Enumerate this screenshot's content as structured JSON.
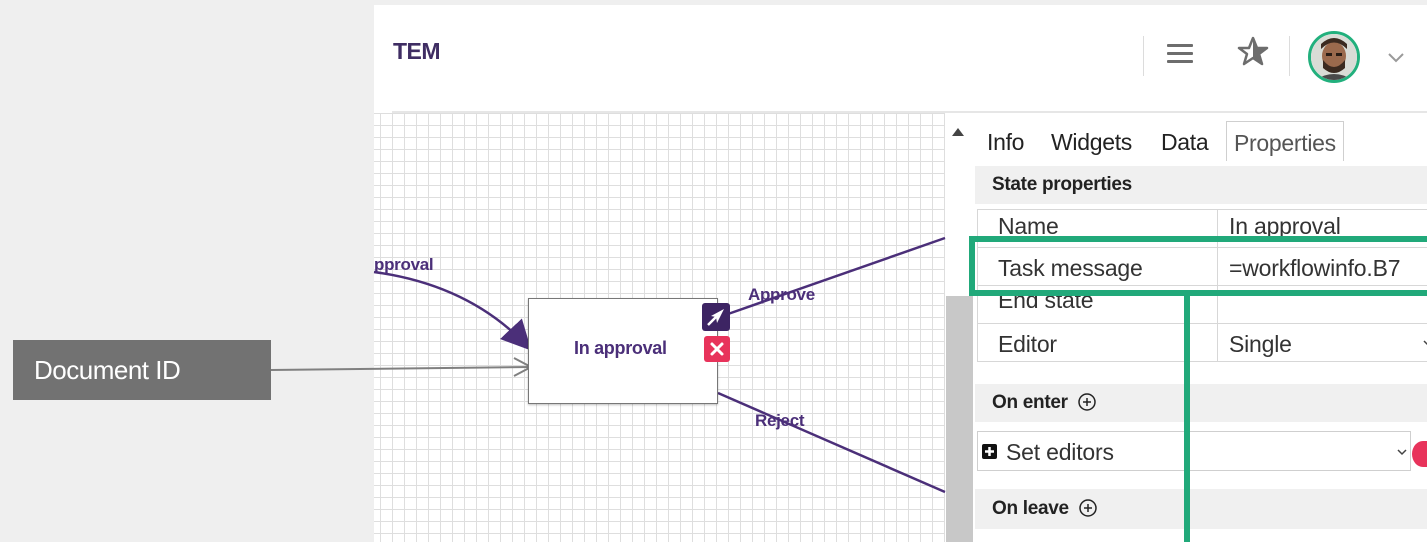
{
  "header": {
    "title": "TEM",
    "menu_icon": "hamburger-menu-icon",
    "star_icon": "star-icon",
    "avatar_icon": "user-avatar",
    "dropdown_icon": "chevron-down-icon"
  },
  "canvas": {
    "state_name": "In approval",
    "incoming_transition_label": "pproval",
    "outgoing_transitions": [
      "Approve",
      "Reject"
    ],
    "state_actions": [
      "send-icon",
      "delete-icon"
    ]
  },
  "callout": {
    "text": "Document ID"
  },
  "panel": {
    "tabs": [
      "Info",
      "Widgets",
      "Data",
      "Properties"
    ],
    "active_tab": "Properties",
    "state_properties_header": "State properties",
    "properties": [
      {
        "key": "Name",
        "value": "In approval"
      },
      {
        "key": "Task message",
        "value": "=workflowinfo.B7"
      },
      {
        "key": "End state",
        "value": ""
      },
      {
        "key": "Editor",
        "value": "Single"
      }
    ],
    "on_enter_header": "On enter",
    "on_enter_actions": [
      {
        "label": "Set editors"
      }
    ],
    "on_leave_header": "On leave"
  },
  "colors": {
    "brand": "#3f2d63",
    "state_text": "#4b2f79",
    "delete_accent": "#e8335b",
    "highlight": "#21a97a",
    "callout_bg": "#727272"
  }
}
